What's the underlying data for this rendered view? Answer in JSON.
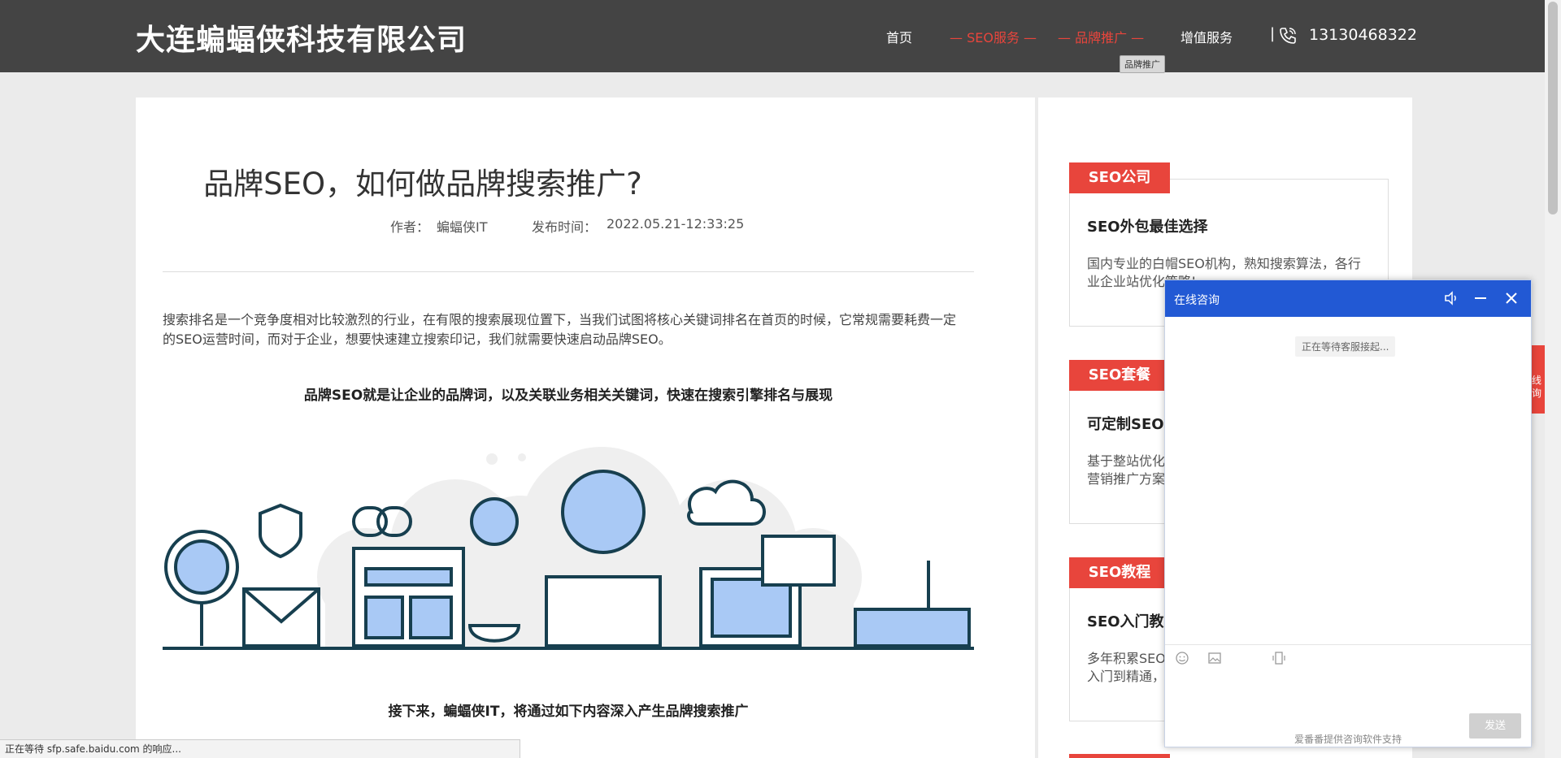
{
  "header": {
    "logo": "大连蝙蝠侠科技有限公司",
    "nav": {
      "home": "首页",
      "seo_service": "— SEO服务 —",
      "brand_promo": "— 品牌推广 —",
      "value_added": "增值服务"
    },
    "separator": "|",
    "phone": "13130468322",
    "tooltip": "品牌推广",
    "accent_color": "#e8453c",
    "bg_color": "#444444"
  },
  "article": {
    "title": "品牌SEO，如何做品牌搜索推广?",
    "author_label": "作者：",
    "author": "蝙蝠侠IT",
    "date_label": "发布时间：",
    "date": "2022.05.21-12:33:25",
    "paragraph": "搜索排名是一个竞争度相对比较激烈的行业，在有限的搜索展现位置下，当我们试图将核心关键词排名在首页的时候，它常规需要耗费一定的SEO运营时间，而对于企业，想要快速建立搜索印记，我们就需要快速启动品牌SEO。",
    "highlight": "品牌SEO就是让企业的品牌词，以及关联业务相关关键词，快速在搜索引擎排名与展现",
    "next_line": "接下来，蝙蝠侠IT，将通过如下内容深入产生品牌搜索推广"
  },
  "sidebar": {
    "boxes": [
      {
        "tag": "SEO公司",
        "heading": "SEO外包最佳选择",
        "text": "国内专业的白帽SEO机构，熟知搜索算法，各行业企业站优化策略!"
      },
      {
        "tag": "SEO套餐",
        "heading": "可定制SEO",
        "text": "基于整站优化营销推广方案"
      },
      {
        "tag": "SEO教程",
        "heading": "SEO入门教",
        "text": "多年积累SEO入门到精通，"
      }
    ]
  },
  "float_tab": "线询",
  "chat": {
    "title": "在线咨询",
    "status": "正在等待客服接起...",
    "send": "发送",
    "footer": "爱番番提供咨询软件支持",
    "header_color": "#2259d4"
  },
  "statusbar": "正在等待 sfp.safe.baidu.com 的响应..."
}
